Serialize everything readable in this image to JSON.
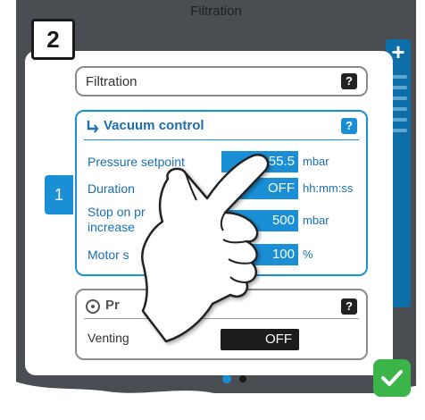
{
  "background": {
    "title": "Filtration",
    "plus_symbol": "+"
  },
  "step_badge": "2",
  "side_indicator": "1",
  "sections": {
    "filtration": {
      "title": "Filtration",
      "help": "?"
    },
    "vacuum_control": {
      "title": "Vacuum control",
      "help": "?",
      "rows": [
        {
          "label": "Pressure setpoint",
          "value": "55.5",
          "unit": "mbar"
        },
        {
          "label": "Duration",
          "value": "OFF",
          "unit": "hh:mm:ss"
        },
        {
          "label_line1": "Stop on pr",
          "label_line2": "increase",
          "value": "500",
          "unit": "mbar"
        },
        {
          "label": "Motor s",
          "value": "100",
          "unit": "%"
        }
      ]
    },
    "process": {
      "title": "Pr",
      "help": "?",
      "venting_label": "Venting",
      "venting_value": "OFF"
    }
  },
  "icons": {
    "vacuum": "arrow-down-right-icon",
    "process": "record-icon",
    "confirm": "checkmark-icon",
    "pointer": "pointing-hand-icon"
  },
  "colors": {
    "accent": "#1a8fd6",
    "confirm": "#3bb54a",
    "screen_bg": "#4a4e52",
    "toggle_dark": "#1c1c1c"
  }
}
